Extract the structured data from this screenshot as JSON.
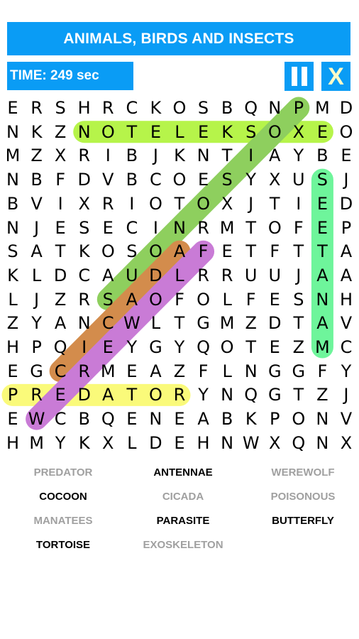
{
  "header": {
    "title": "ANIMALS, BIRDS AND INSECTS",
    "timer_label": "TIME: 249 sec",
    "pause_icon": "pause-icon",
    "close_label": "X"
  },
  "colors": {
    "accent": "#0a9cf5",
    "found_word": "#a0a0a0",
    "pending_word": "#000000"
  },
  "grid": {
    "rows": [
      "ERSHRCKOSBQNPMD",
      "NKZNOTELEKSOXEO",
      "MZXRIBJKNTIAYBE",
      "NBFDVBCOESYXUSJ",
      "BVIXRIOTOXJTIED",
      "NJESECINRMTOFEP",
      "SATKOSOAFETFTTA",
      "KLDCAUDLRRUUJAA",
      "LJZRSAOFOLFESNH",
      "ZYANCWLTGMZDTAV",
      "HPQIEYGYQOTEZMC",
      "EGCRMEAZFLNGGFY",
      "PREDATORYNQGTZJ",
      "EWCBQENEABKPONV",
      "HMYKXLDEHNWXQNX"
    ]
  },
  "highlights": [
    {
      "word": "EXOSKELETON",
      "start": [
        2,
        14
      ],
      "end": [
        2,
        4
      ],
      "color": "#b6f44a"
    },
    {
      "word": "POISONOUS",
      "start": [
        1,
        13
      ],
      "end": [
        9,
        5
      ],
      "color": "#8ecf5e"
    },
    {
      "word": "MANATEES",
      "start": [
        11,
        14
      ],
      "end": [
        4,
        14
      ],
      "color": "#6ef59b"
    },
    {
      "word": "CICADA",
      "start": [
        12,
        3
      ],
      "end": [
        7,
        8
      ],
      "color": "#d38c4c"
    },
    {
      "word": "PREDATOR",
      "start": [
        13,
        1
      ],
      "end": [
        13,
        8
      ],
      "color": "#fafa7a"
    },
    {
      "word": "WEREWOLF",
      "start": [
        14,
        2
      ],
      "end": [
        7,
        9
      ],
      "color": "#c97bd6"
    }
  ],
  "word_list": [
    {
      "text": "PREDATOR",
      "found": true
    },
    {
      "text": "ANTENNAE",
      "found": false
    },
    {
      "text": "WEREWOLF",
      "found": true
    },
    {
      "text": "COCOON",
      "found": false
    },
    {
      "text": "CICADA",
      "found": true
    },
    {
      "text": "POISONOUS",
      "found": true
    },
    {
      "text": "MANATEES",
      "found": true
    },
    {
      "text": "PARASITE",
      "found": false
    },
    {
      "text": "BUTTERFLY",
      "found": false
    },
    {
      "text": "TORTOISE",
      "found": false
    },
    {
      "text": "EXOSKELETON",
      "found": true
    }
  ]
}
